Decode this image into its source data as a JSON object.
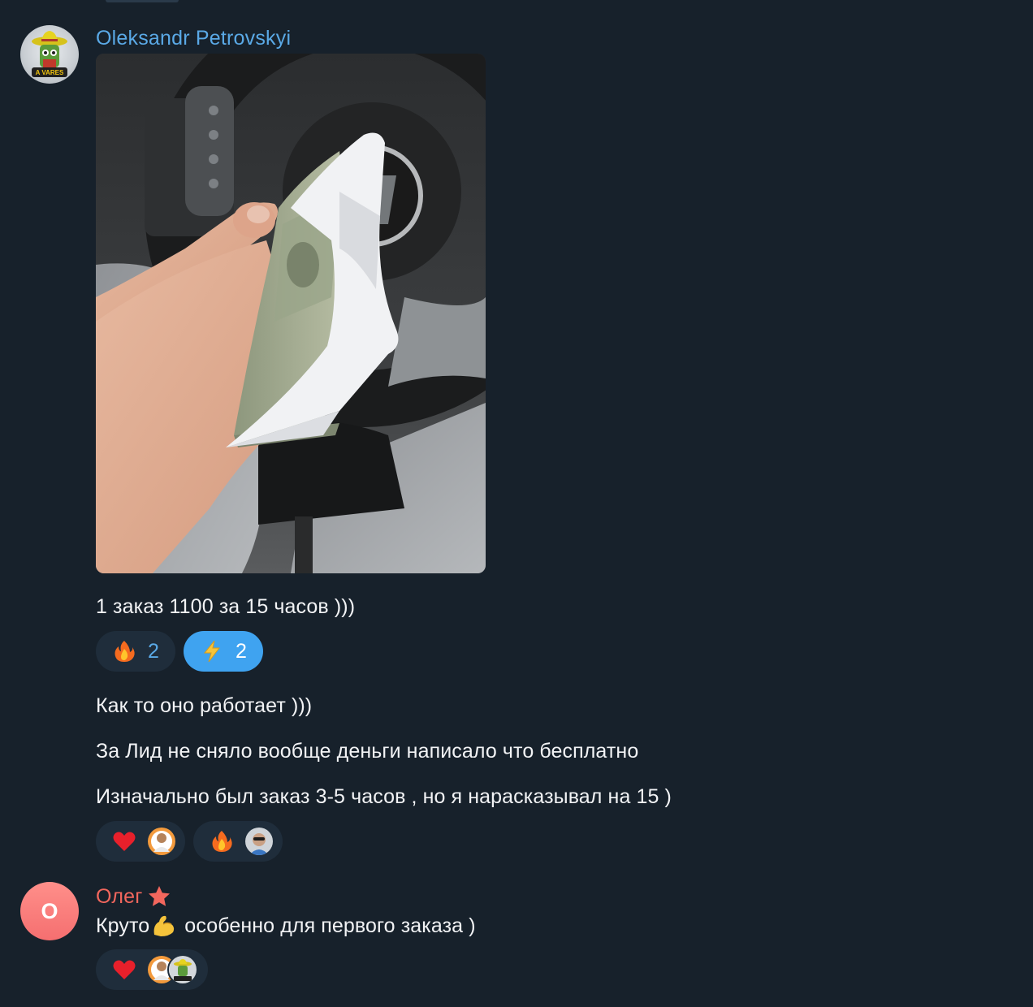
{
  "messages": [
    {
      "sender": "Oleksandr Petrovskyi",
      "sender_color": "#5aa9e6",
      "avatar": {
        "text": "A VARES",
        "icon": "sombrero-avatar-icon"
      },
      "photo": {
        "icon": "cash-envelope-photo"
      },
      "caption": "1 заказ 1100 за 15 часов )))",
      "reactions": [
        {
          "emoji": "fire-icon",
          "count": "2",
          "active": false
        },
        {
          "emoji": "lightning-icon",
          "count": "2",
          "active": true
        }
      ]
    },
    {
      "lines": [
        "Как то оно работает )))",
        "За Лид не сняло вообще деньги написало что бесплатно",
        "Изначально был заказ 3-5 часов , но я нарасказывал на 15 )"
      ],
      "reactions": [
        {
          "emoji": "heart-icon",
          "avatars": [
            "user-avatar-orange"
          ]
        },
        {
          "emoji": "fire-icon",
          "avatars": [
            "user-avatar-sunglasses"
          ]
        }
      ]
    },
    {
      "sender": "Олег",
      "sender_color": "#f3675d",
      "sender_badge": "star-icon",
      "avatar": {
        "letter": "О",
        "color": "#f56f70"
      },
      "text_before": "Круто",
      "text_emoji": "flexed-biceps-icon",
      "text_after": " особенно для первого заказа )",
      "reactions": [
        {
          "emoji": "heart-icon",
          "avatars": [
            "user-avatar-orange",
            "sombrero-avatar-icon"
          ]
        }
      ]
    }
  ],
  "colors": {
    "background": "#17212b",
    "reaction_bg": "#1f2d3b",
    "reaction_active": "#3fa3f0",
    "link_blue": "#5aa9e6"
  }
}
